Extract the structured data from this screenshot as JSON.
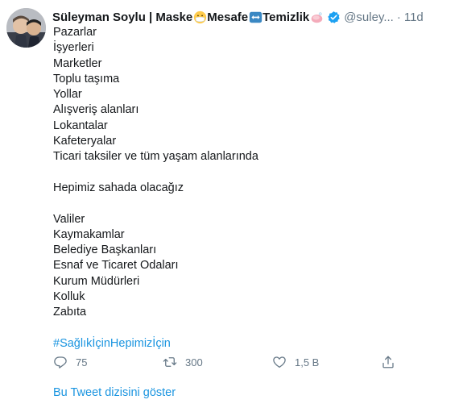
{
  "author": {
    "name": "Süleyman Soylu | Maske",
    "name_part2": " Mesafe",
    "name_part3": " Temizlik",
    "handle": "@suley...",
    "separator": "·",
    "time": "11d"
  },
  "icons": {
    "mask": "mask-emoji",
    "arrows": "left-right-arrow-emoji",
    "soap": "soap-emoji",
    "verified": "verified-badge",
    "reply": "reply-icon",
    "retweet": "retweet-icon",
    "like": "like-icon",
    "share": "share-icon"
  },
  "tweet": {
    "group1": [
      "Pazarlar",
      "İşyerleri",
      "Marketler",
      "Toplu taşıma",
      "Yollar",
      "Alışveriş alanları",
      "Lokantalar",
      "Kafeteryalar",
      "Ticari taksiler ve tüm yaşam alanlarında"
    ],
    "statement": "Hepimiz sahada olacağız",
    "group2": [
      "Valiler",
      "Kaymakamlar",
      "Belediye Başkanları",
      "Esnaf ve Ticaret Odaları",
      "Kurum Müdürleri",
      "Kolluk",
      "Zabıta"
    ],
    "hashtag": "#SağlıkİçinHepimizİçin"
  },
  "stats": {
    "replies": "75",
    "retweets": "300",
    "likes": "1,5 B"
  },
  "thread_link": "Bu Tweet dizisini göster",
  "colors": {
    "link": "#1b95e0",
    "muted": "#657786",
    "verified": "#1da1f2",
    "text": "#14171a"
  }
}
